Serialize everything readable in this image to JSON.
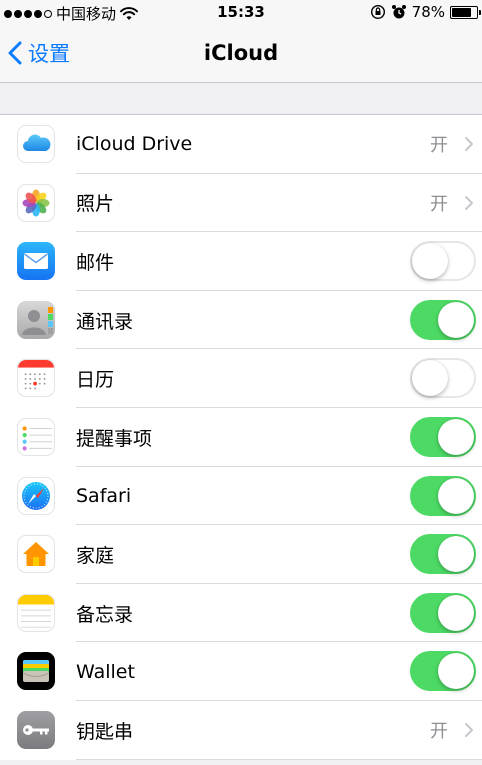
{
  "status_bar": {
    "carrier": "中国移动",
    "time": "15:33",
    "battery": "78%",
    "battery_level": 0.78
  },
  "nav": {
    "back_label": "设置",
    "title": "iCloud"
  },
  "rows": [
    {
      "label": "iCloud Drive",
      "value": "开",
      "icon": "icloud-drive-icon"
    },
    {
      "label": "照片",
      "value": "开",
      "icon": "photos-icon"
    },
    {
      "label": "邮件",
      "toggle": false,
      "icon": "mail-icon"
    },
    {
      "label": "通讯录",
      "toggle": true,
      "icon": "contacts-icon"
    },
    {
      "label": "日历",
      "toggle": false,
      "icon": "calendar-icon"
    },
    {
      "label": "提醒事项",
      "toggle": true,
      "icon": "reminders-icon"
    },
    {
      "label": "Safari",
      "toggle": true,
      "icon": "safari-icon"
    },
    {
      "label": "家庭",
      "toggle": true,
      "icon": "home-icon"
    },
    {
      "label": "备忘录",
      "toggle": true,
      "icon": "notes-icon"
    },
    {
      "label": "Wallet",
      "toggle": true,
      "icon": "wallet-icon"
    },
    {
      "label": "钥匙串",
      "value": "开",
      "icon": "keychain-icon"
    }
  ],
  "colors": {
    "accent": "#0a7aff",
    "toggle_on": "#4cd964",
    "background": "#efeff4"
  }
}
